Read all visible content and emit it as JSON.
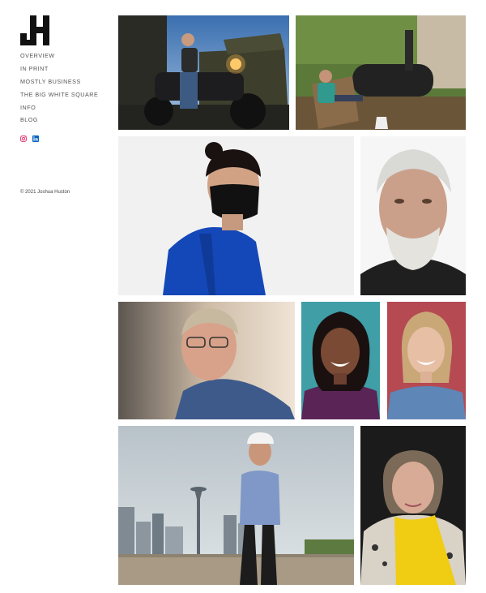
{
  "brand": {
    "logo_text": "JH"
  },
  "nav": {
    "items": [
      {
        "label": "OVERVIEW"
      },
      {
        "label": "IN PRINT"
      },
      {
        "label": "MOSTLY BUSINESS"
      },
      {
        "label": "THE BIG WHITE SQUARE"
      },
      {
        "label": "INFO"
      },
      {
        "label": "BLOG"
      }
    ]
  },
  "social": [
    {
      "icon": "instagram-icon",
      "color": "#e1306c"
    },
    {
      "icon": "linkedin-icon",
      "color": "#0a66c2"
    }
  ],
  "footer": {
    "copyright": "© 2021 Joshua Huston"
  },
  "gallery": [
    {
      "name": "man-on-motorcycle"
    },
    {
      "name": "man-in-adirondack-chair-with-smoker-and-dog"
    },
    {
      "name": "woman-in-blue-hoodie-with-face-mask"
    },
    {
      "name": "older-man-with-white-beard"
    },
    {
      "name": "man-with-glasses-in-blue-shirt"
    },
    {
      "name": "smiling-woman-teal-background"
    },
    {
      "name": "smiling-woman-red-background"
    },
    {
      "name": "man-in-cap-with-seattle-skyline"
    },
    {
      "name": "older-woman-with-yellow-scarf"
    }
  ]
}
